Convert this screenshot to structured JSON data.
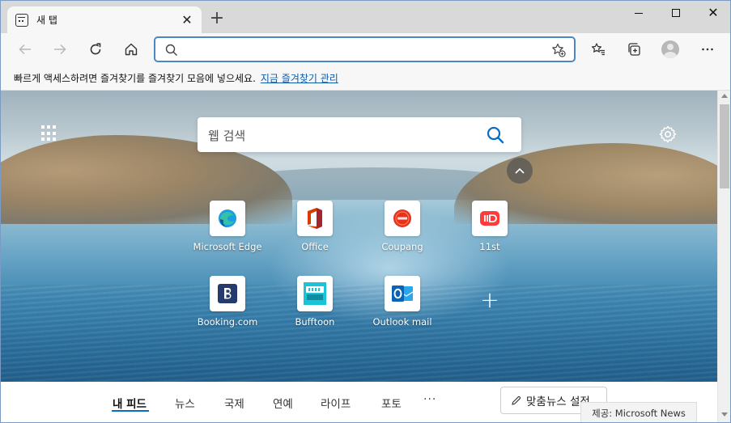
{
  "tab": {
    "title": "새 탭",
    "close": "✕"
  },
  "new_tab": "+",
  "window_controls": {
    "close": "✕"
  },
  "address_bar": {
    "value": "",
    "placeholder": ""
  },
  "favorites_bar": {
    "message": "빠르게 액세스하려면 즐겨찾기를 즐겨찾기 모음에 넣으세요.",
    "link": "지금 즐겨찾기 관리"
  },
  "search": {
    "placeholder": "웹 검색"
  },
  "tiles": [
    {
      "label": "Microsoft Edge",
      "icon": "edge-icon"
    },
    {
      "label": "Office",
      "icon": "office-icon"
    },
    {
      "label": "Coupang",
      "icon": "coupang-icon"
    },
    {
      "label": "11st",
      "icon": "11st-icon"
    },
    {
      "label": "Booking.com",
      "icon": "booking-icon"
    },
    {
      "label": "Bufftoon",
      "icon": "bufftoon-icon"
    },
    {
      "label": "Outlook mail",
      "icon": "outlook-icon"
    }
  ],
  "add_tile": "+",
  "feed": {
    "tabs": [
      "내 피드",
      "뉴스",
      "국제",
      "연예",
      "라이프",
      "포토"
    ],
    "more": "···",
    "customize": "맞춤뉴스 설정"
  },
  "provider": "제공: Microsoft News",
  "colors": {
    "accent": "#0b6cc0",
    "address_border": "#4a86c8",
    "link": "#0b5cad"
  }
}
